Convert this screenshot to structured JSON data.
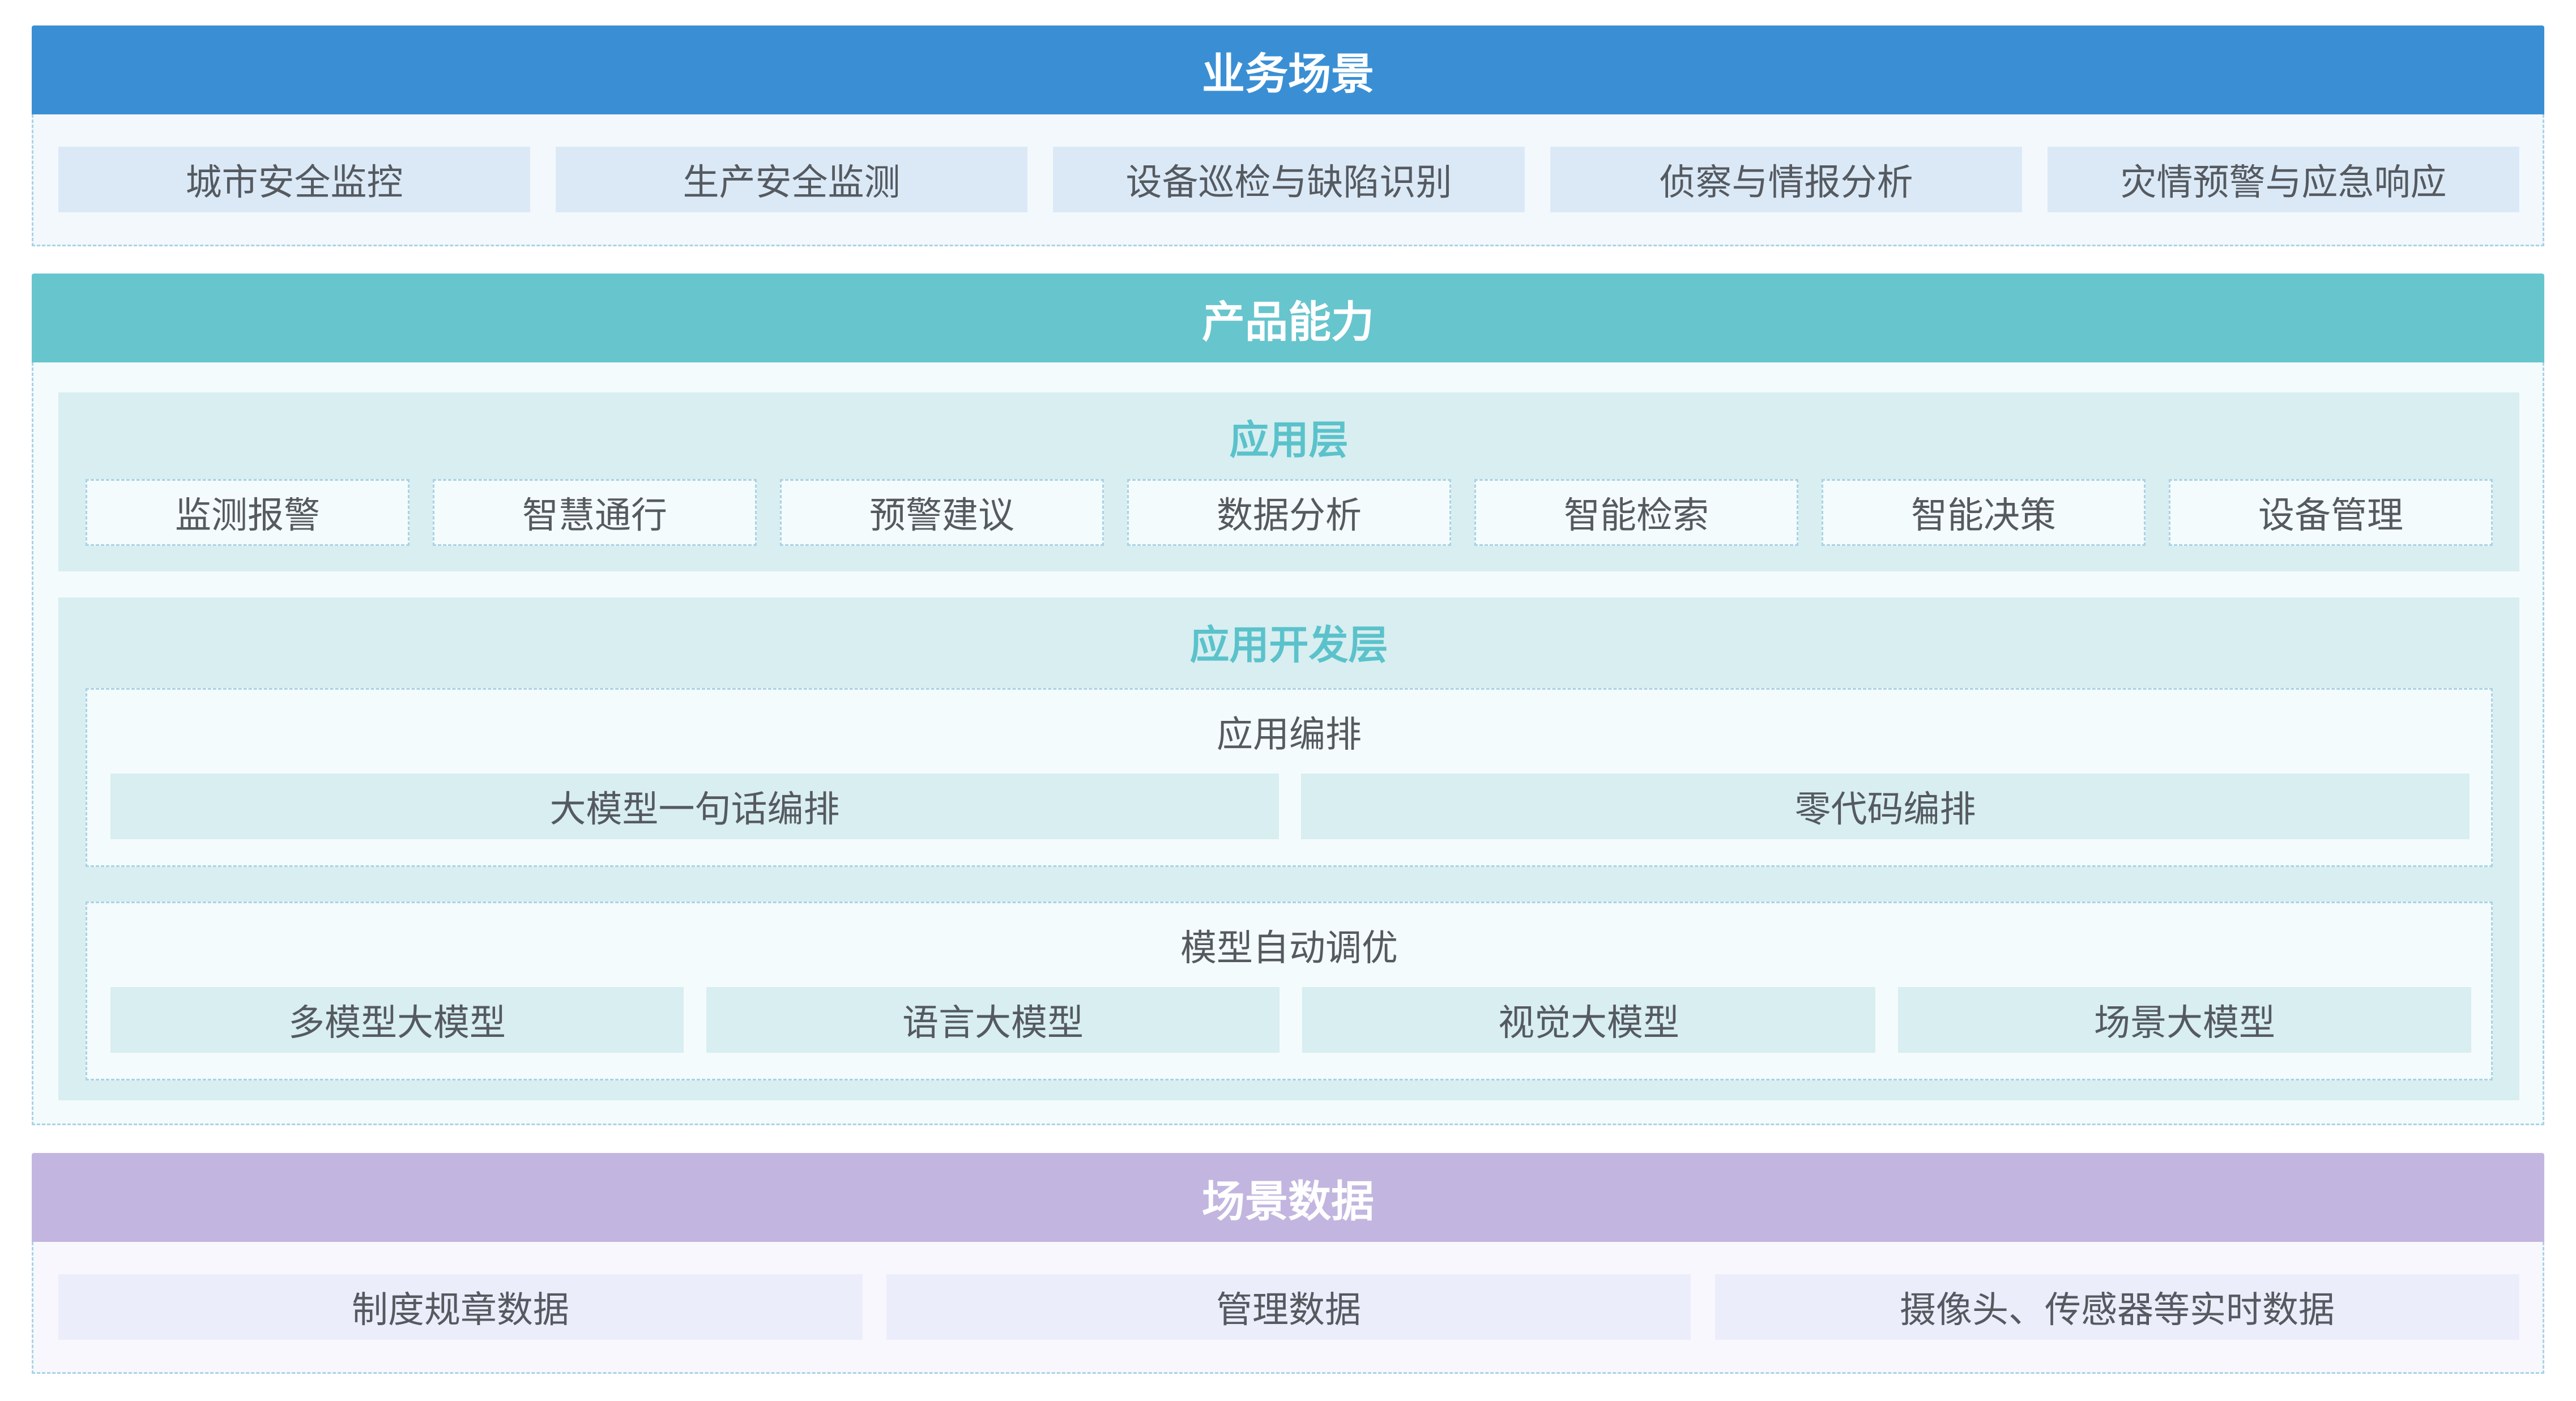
{
  "business": {
    "title": "业务场景",
    "items": [
      "城市安全监控",
      "生产安全监测",
      "设备巡检与缺陷识别",
      "侦察与情报分析",
      "灾情预警与应急响应"
    ]
  },
  "product": {
    "title": "产品能力",
    "app_layer": {
      "title": "应用层",
      "items": [
        "监测报警",
        "智慧通行",
        "预警建议",
        "数据分析",
        "智能检索",
        "智能决策",
        "设备管理"
      ]
    },
    "dev_layer": {
      "title": "应用开发层",
      "orchestration": {
        "title": "应用编排",
        "items": [
          "大模型一句话编排",
          "零代码编排"
        ]
      },
      "tuning": {
        "title": "模型自动调优",
        "items": [
          "多模型大模型",
          "语言大模型",
          "视觉大模型",
          "场景大模型"
        ]
      }
    }
  },
  "data": {
    "title": "场景数据",
    "items": [
      "制度规章数据",
      "管理数据",
      "摄像头、传感器等实时数据"
    ]
  },
  "colors": {
    "business_banner": "#3a8fd4",
    "product_banner": "#67c5cd",
    "data_banner": "#c2b6e0"
  }
}
